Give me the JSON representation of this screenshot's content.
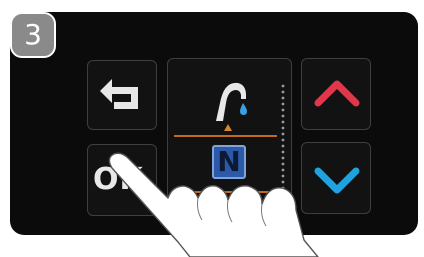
{
  "step": {
    "number": "3"
  },
  "buttons": {
    "ok_label": "OK",
    "back_icon": "return-arrow-icon",
    "up_icon": "chevron-up-icon",
    "down_icon": "chevron-down-icon"
  },
  "display": {
    "mode_letter": "N",
    "tap_icon": "faucet-water-drop-icon",
    "indicator_icon": "triangle-up-icon"
  },
  "colors": {
    "panel": "#0b0b0b",
    "up_arrow": "#e0374b",
    "down_arrow": "#1fa3e0",
    "divider": "#c46a1e",
    "mode_badge": "#2d5aa8",
    "water_drop": "#3aa0e6"
  }
}
